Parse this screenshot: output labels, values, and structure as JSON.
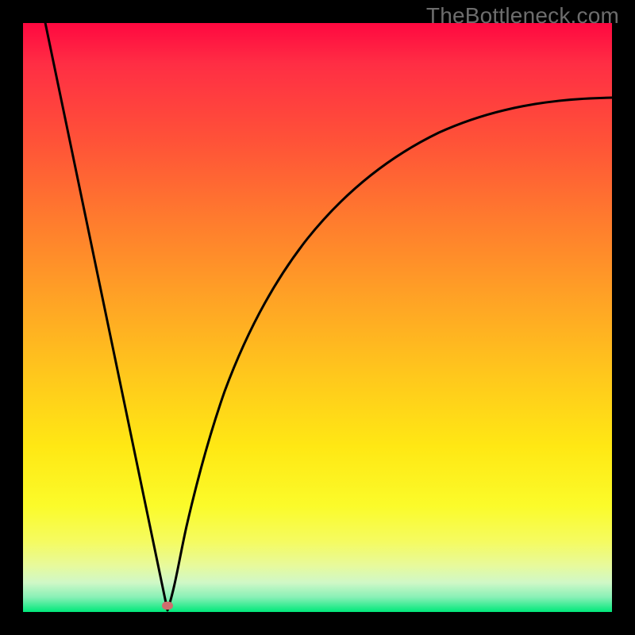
{
  "watermark": "TheBottleneck.com",
  "colors": {
    "frame": "#000000",
    "curve": "#000000",
    "marker": "#cf6d6d"
  },
  "chart_data": {
    "type": "line",
    "title": "",
    "xlabel": "",
    "ylabel": "",
    "xlim": [
      0,
      100
    ],
    "ylim": [
      0,
      100
    ],
    "series": [
      {
        "name": "bottleneck-curve-left",
        "x": [
          3.5,
          24.5
        ],
        "y": [
          100,
          0
        ]
      },
      {
        "name": "bottleneck-curve-right",
        "x": [
          24.5,
          27,
          30,
          34,
          39,
          46,
          55,
          66,
          80,
          100
        ],
        "y": [
          0,
          12,
          25,
          38,
          50,
          61,
          70,
          77,
          82.5,
          87
        ]
      }
    ],
    "marker": {
      "x": 24.5,
      "y": 0.5
    },
    "grid": false,
    "legend": false
  }
}
